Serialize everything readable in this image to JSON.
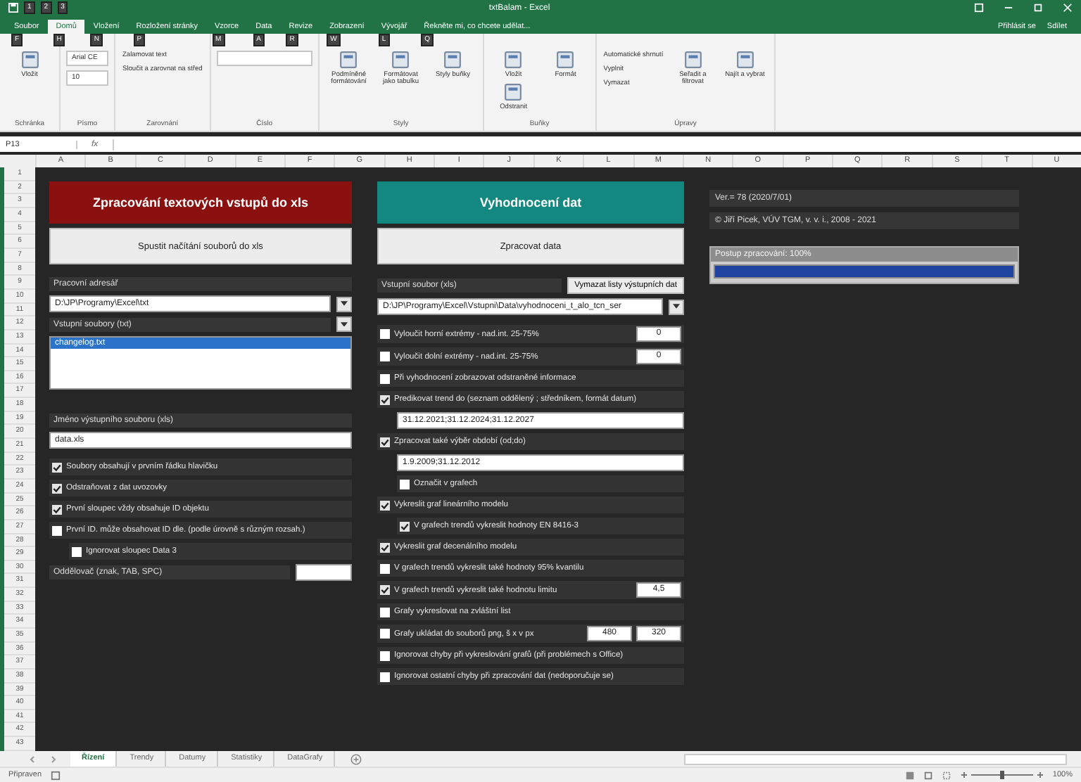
{
  "window": {
    "title": "txtBalam - Excel",
    "quick_access_keytips": [
      "1",
      "2",
      "3"
    ]
  },
  "ribbon": {
    "tabs": [
      {
        "label": "Soubor",
        "selected": false,
        "keytip": "F"
      },
      {
        "label": "Domů",
        "selected": true,
        "keytip": "H"
      },
      {
        "label": "Vložení",
        "selected": false,
        "keytip": "N"
      },
      {
        "label": "Rozložení stránky",
        "selected": false,
        "keytip": "P"
      },
      {
        "label": "Vzorce",
        "selected": false,
        "keytip": "M"
      },
      {
        "label": "Data",
        "selected": false,
        "keytip": "A"
      },
      {
        "label": "Revize",
        "selected": false,
        "keytip": "R"
      },
      {
        "label": "Zobrazení",
        "selected": false,
        "keytip": "W"
      },
      {
        "label": "Vývojář",
        "selected": false,
        "keytip": "L"
      }
    ],
    "tell_me": "Řekněte mi, co chcete udělat...",
    "tell_me_keytip": "Q",
    "sign_in": "Přihlásit se",
    "share": "Sdílet",
    "groups": [
      {
        "label": "Schránka",
        "buttons": [
          {
            "kind": "large",
            "label": "Vložit"
          }
        ]
      },
      {
        "label": "Písmo",
        "buttons": [
          {
            "kind": "combo",
            "label": "Arial CE"
          },
          {
            "kind": "combo",
            "label": "10"
          }
        ]
      },
      {
        "label": "Zarovnání",
        "buttons": [
          {
            "kind": "small",
            "label": "Zalamovat text"
          },
          {
            "kind": "small",
            "label": "Sloučit a zarovnat na střed"
          }
        ]
      },
      {
        "label": "Číslo",
        "buttons": [
          {
            "kind": "blank"
          }
        ]
      },
      {
        "label": "Styly",
        "buttons": [
          {
            "kind": "large",
            "label": "Podmíněné formátování"
          },
          {
            "kind": "large",
            "label": "Formátovat jako tabulku"
          },
          {
            "kind": "large",
            "label": "Styly buňky"
          }
        ]
      },
      {
        "label": "Buňky",
        "buttons": [
          {
            "kind": "large",
            "label": "Vložit"
          },
          {
            "kind": "large",
            "label": "Odstranit"
          },
          {
            "kind": "large",
            "label": "Formát"
          }
        ]
      },
      {
        "label": "Úpravy",
        "buttons": [
          {
            "kind": "small",
            "label": "Automatické shrnutí"
          },
          {
            "kind": "small",
            "label": "Vyplnit"
          },
          {
            "kind": "small",
            "label": "Vymazat"
          },
          {
            "kind": "large",
            "label": "Seřadit a filtrovat"
          },
          {
            "kind": "large",
            "label": "Najít a vybrat"
          }
        ]
      }
    ]
  },
  "formula_bar": {
    "name_box": "P13",
    "fx": "fx"
  },
  "columns": [
    "A",
    "B",
    "C",
    "D",
    "E",
    "F",
    "G",
    "H",
    "I",
    "J",
    "K",
    "L",
    "M",
    "N",
    "O",
    "P",
    "Q",
    "R",
    "S",
    "T",
    "U"
  ],
  "rows": [
    "1",
    "2",
    "3",
    "4",
    "5",
    "6",
    "7",
    "8",
    "9",
    "10",
    "11",
    "12",
    "13",
    "14",
    "15",
    "16",
    "17",
    "18",
    "19",
    "20",
    "21",
    "22",
    "23",
    "24",
    "25",
    "26",
    "27",
    "28",
    "29",
    "30",
    "31",
    "32",
    "33",
    "34",
    "35",
    "36",
    "37",
    "38",
    "39",
    "40",
    "41",
    "42",
    "43"
  ],
  "left_panel": {
    "header": "Zpracování textových vstupů do xls",
    "run_button": "Spustit načítání souborů do xls",
    "folder_label": "Pracovní adresář",
    "folder_value": "D:\\JP\\Programy\\Excel\\txt",
    "files_label": "Vstupní soubory (txt)",
    "files": [
      {
        "name": "changelog.txt",
        "selected": true
      }
    ],
    "output_label": "Jméno výstupního souboru (xls)",
    "output_value": "data.xls",
    "options": [
      {
        "label": "Soubory obsahují v prvním řádku hlavičku",
        "checked": true
      },
      {
        "label": "Odstraňovat z dat uvozovky",
        "checked": true
      },
      {
        "label": "První sloupec vždy obsahuje ID objektu",
        "checked": true
      },
      {
        "label": "První ID. může obsahovat ID dle. (podle úrovně s různým rozsah.)",
        "checked": false,
        "children": [
          {
            "label": "Ignorovat sloupec Data 3",
            "checked": false
          }
        ]
      }
    ],
    "separator_label": "Oddělovač (znak, TAB, SPC)"
  },
  "middle_panel": {
    "header": "Vyhodnocení dat",
    "process_button": "Zpracovat data",
    "input_label": "Vstupní soubor (xls)",
    "clear_button": "Vymazat listy výstupních dat",
    "input_value": "D:\\JP\\Programy\\Excel\\Vstupni\\Data\\vyhodnoceni_t_alo_tcn_ser",
    "options": [
      {
        "label": "Vyloučit horní extrémy - nad.int. 25-75%",
        "checked": false,
        "values": [
          "0"
        ]
      },
      {
        "label": "Vyloučit dolní extrémy - nad.int. 25-75%",
        "checked": false,
        "values": [
          "0"
        ]
      },
      {
        "label": "Při vyhodnocení zobrazovat odstraněné informace",
        "checked": false
      },
      {
        "label": "Predikovat trend do (seznam oddělený ; středníkem, formát datum)",
        "checked": true,
        "field": "31.12.2021;31.12.2024;31.12.2027"
      },
      {
        "label": "Zpracovat také výběr období (od;do)",
        "checked": true,
        "field": "1.9.2009;31.12.2012",
        "children": [
          {
            "label": "Označit v grafech",
            "checked": false
          }
        ]
      },
      {
        "label": "Vykreslit graf lineárního modelu",
        "checked": true,
        "children": [
          {
            "label": "V grafech trendů vykreslit hodnoty EN 8416-3",
            "checked": true
          }
        ]
      },
      {
        "label": "Vykreslit graf decenálního modelu",
        "checked": true
      },
      {
        "label": "V grafech trendů vykreslit také hodnoty 95% kvantilu",
        "checked": false
      },
      {
        "label": "V grafech trendů vykreslit také hodnotu limitu",
        "checked": true,
        "values": [
          "4,5"
        ]
      },
      {
        "label": "Grafy vykreslovat na zvláštní list",
        "checked": false
      },
      {
        "label": "Grafy ukládat do souborů png, š x v px",
        "checked": false,
        "values": [
          "480",
          "320"
        ]
      },
      {
        "label": "Ignorovat chyby při vykreslování grafů (při problémech s Office)",
        "checked": false
      },
      {
        "label": "Ignorovat ostatní chyby při zpracování dat (nedoporučuje se)",
        "checked": false
      }
    ]
  },
  "info_panel": {
    "version": "Ver.= 78 (2020/7/01)",
    "copyright": "© Jiří Picek, VÚV TGM, v. v. i., 2008 - 2021",
    "progress_label": "Postup zpracování: 100%",
    "level": 1
  },
  "sheet_tabs": [
    {
      "label": "Řízení",
      "selected": true
    },
    {
      "label": "Trendy",
      "selected": false
    },
    {
      "label": "Datumy",
      "selected": false
    },
    {
      "label": "Statistiky",
      "selected": false
    },
    {
      "label": "DataGrafy",
      "selected": false
    }
  ],
  "status_bar": {
    "mode": "Připraven",
    "zoom": "100%",
    "zoom_slider": {
      "level": 0.5
    }
  }
}
